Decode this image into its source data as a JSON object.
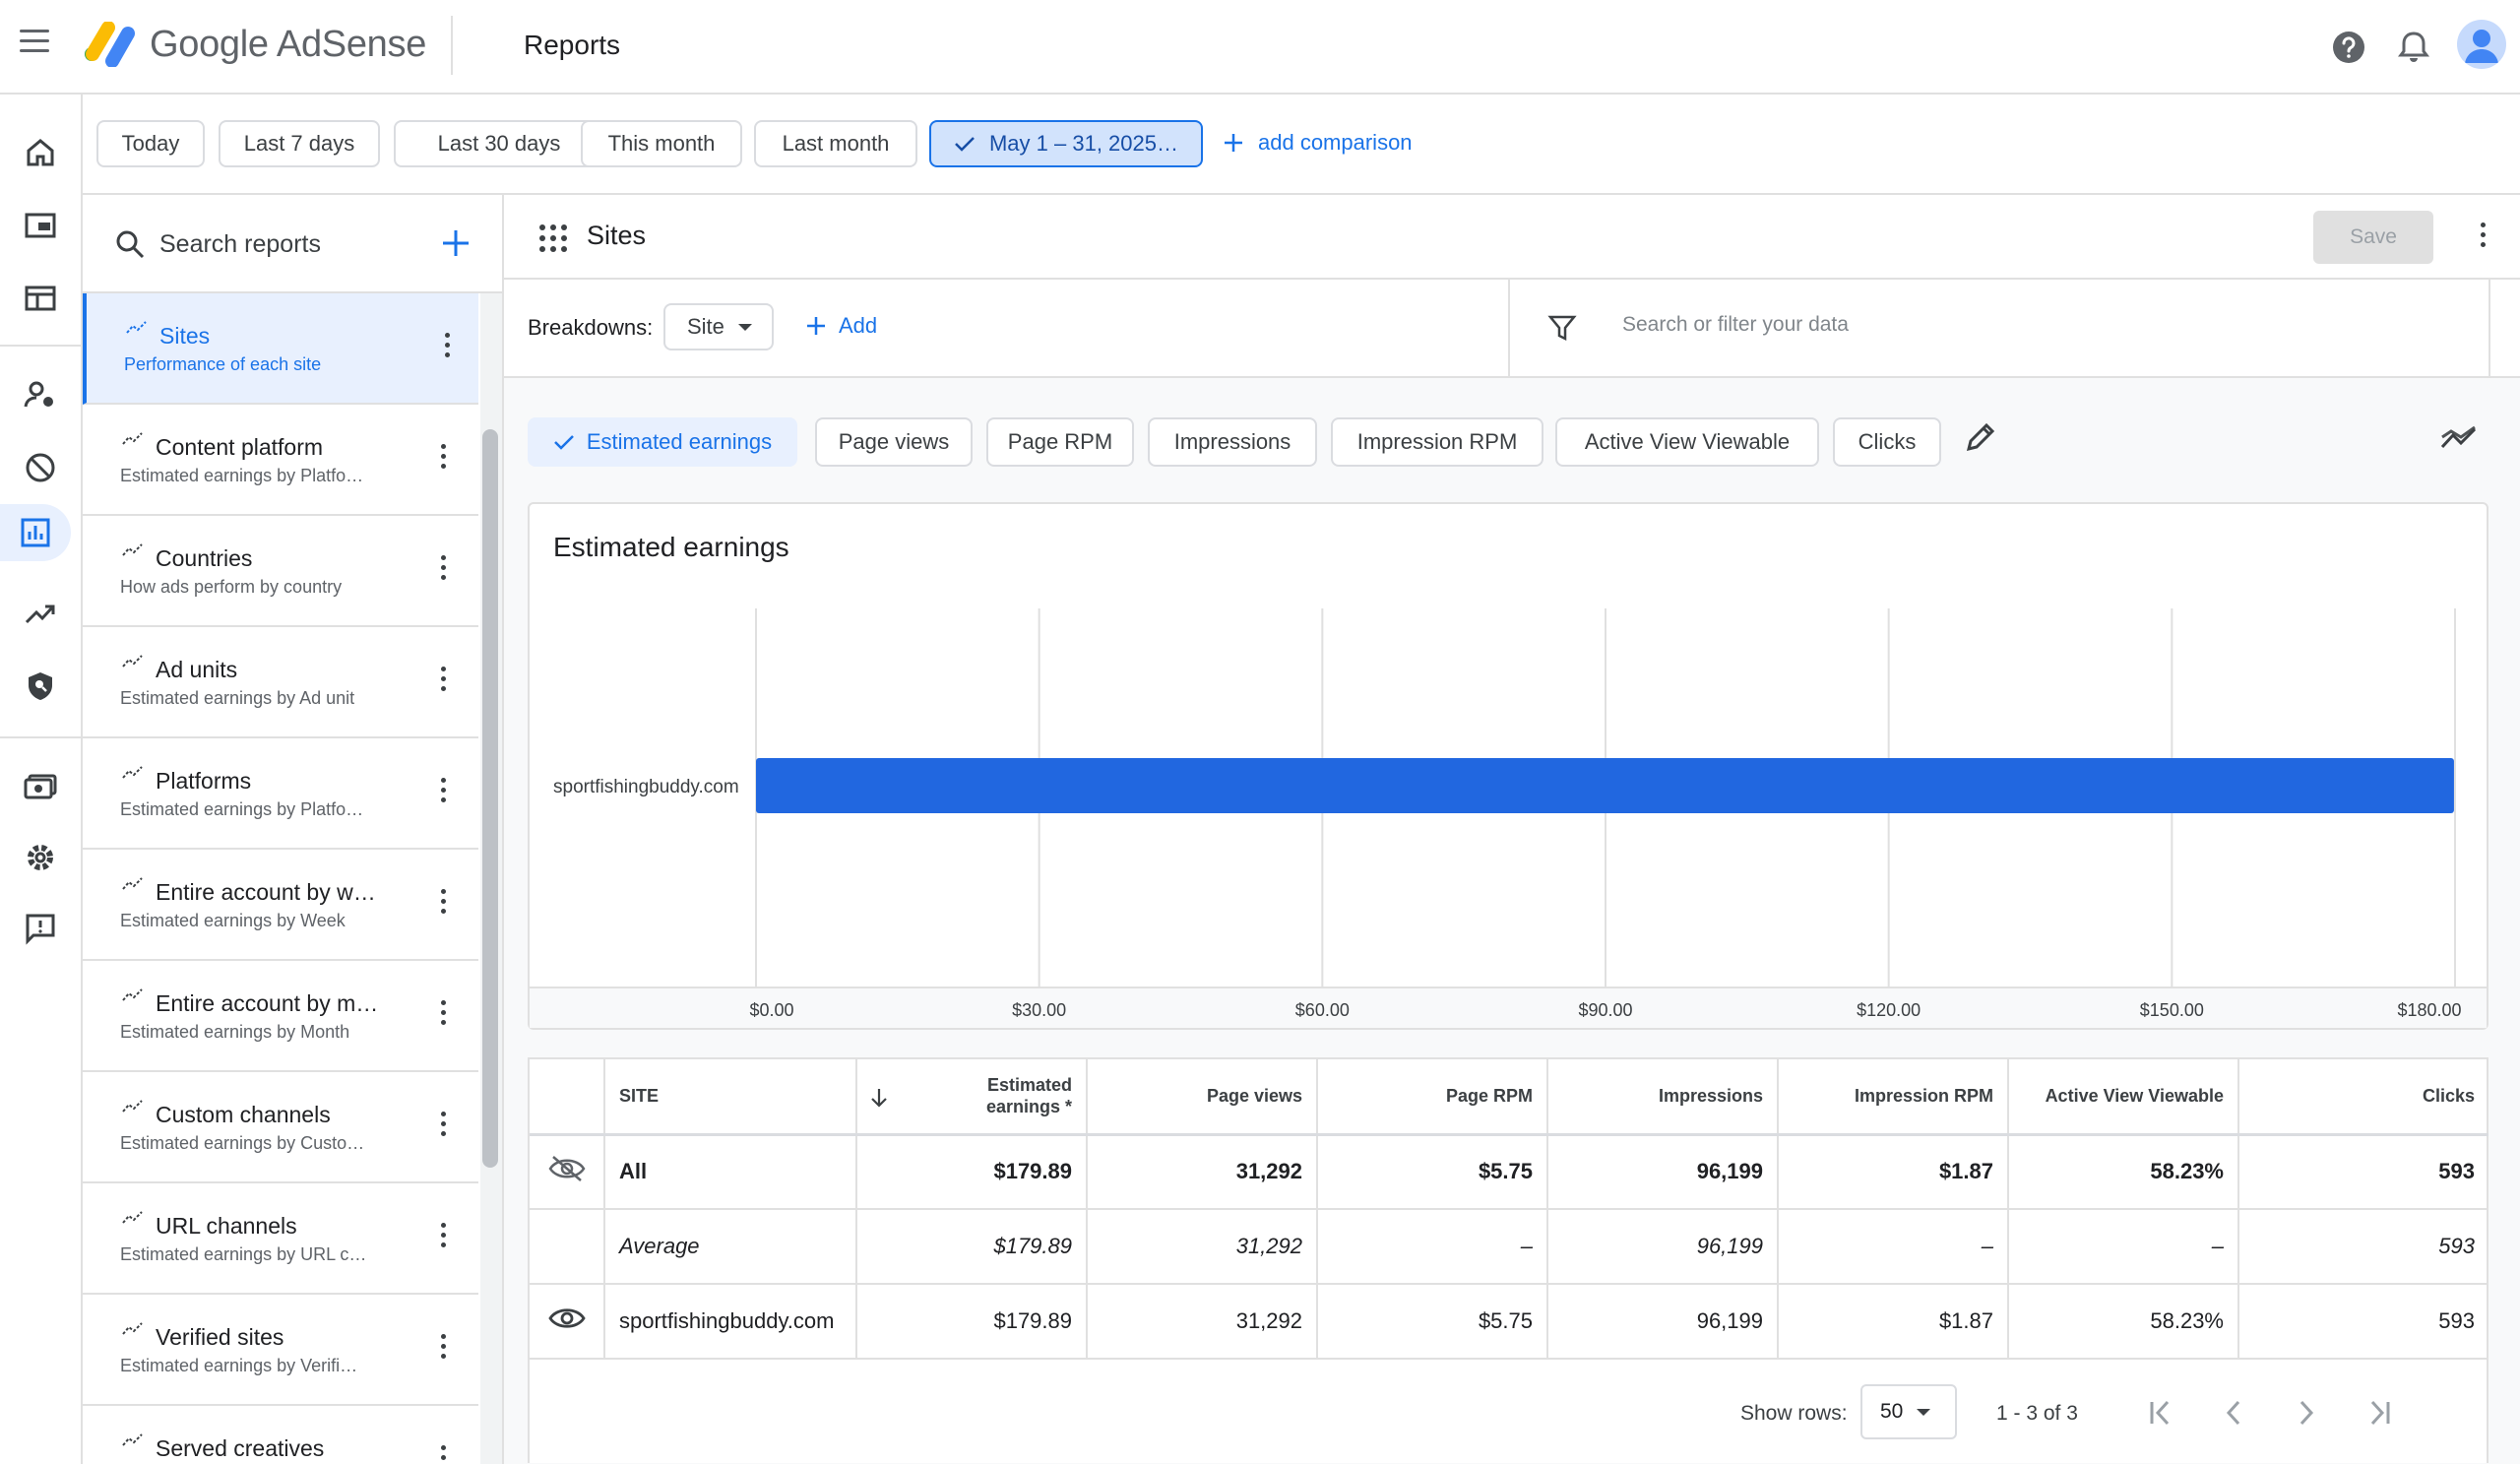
{
  "app": {
    "brand": "Google AdSense",
    "page_title": "Reports"
  },
  "date_filters": {
    "chips": [
      "Today",
      "Last 7 days",
      "Last 30 days",
      "This month",
      "Last month"
    ],
    "selected": "May 1 – 31, 2025…",
    "add_comparison": "add comparison"
  },
  "sidebar": {
    "search_label": "Search reports",
    "reports": [
      {
        "title": "Sites",
        "subtitle": "Performance of each site"
      },
      {
        "title": "Content platform",
        "subtitle": "Estimated earnings by Platfo…"
      },
      {
        "title": "Countries",
        "subtitle": "How ads perform by country"
      },
      {
        "title": "Ad units",
        "subtitle": "Estimated earnings by Ad unit"
      },
      {
        "title": "Platforms",
        "subtitle": "Estimated earnings by Platfo…"
      },
      {
        "title": "Entire account by w…",
        "subtitle": "Estimated earnings by Week"
      },
      {
        "title": "Entire account by m…",
        "subtitle": "Estimated earnings by Month"
      },
      {
        "title": "Custom channels",
        "subtitle": "Estimated earnings by Custo…"
      },
      {
        "title": "URL channels",
        "subtitle": "Estimated earnings by URL c…"
      },
      {
        "title": "Verified sites",
        "subtitle": "Estimated earnings by Verifi…"
      },
      {
        "title": "Served creatives",
        "subtitle": ""
      }
    ]
  },
  "main": {
    "title": "Sites",
    "save_label": "Save",
    "breakdowns_label": "Breakdowns:",
    "breakdown_value": "Site",
    "add_label": "Add",
    "filter_placeholder": "Search or filter your data",
    "metrics": [
      "Estimated earnings",
      "Page views",
      "Page RPM",
      "Impressions",
      "Impression RPM",
      "Active View Viewable",
      "Clicks"
    ]
  },
  "chart_data": {
    "type": "bar",
    "orientation": "horizontal",
    "title": "Estimated earnings",
    "categories": [
      "sportfishingbuddy.com"
    ],
    "values": [
      179.89
    ],
    "xlim": [
      0,
      180
    ],
    "x_ticks": [
      "$0.00",
      "$30.00",
      "$60.00",
      "$90.00",
      "$120.00",
      "$150.00",
      "$180.00"
    ],
    "x_tick_values": [
      0,
      30,
      60,
      90,
      120,
      150,
      180
    ],
    "grid": true,
    "bar_color": "#2167e0"
  },
  "table": {
    "headers": [
      "SITE",
      "Estimated earnings *",
      "Page views",
      "Page RPM",
      "Impressions",
      "Impression RPM",
      "Active View Viewable",
      "Clicks"
    ],
    "rows": [
      {
        "site": "All",
        "cells": [
          "$179.89",
          "31,292",
          "$5.75",
          "96,199",
          "$1.87",
          "58.23%",
          "593"
        ]
      },
      {
        "site": "Average",
        "cells": [
          "$179.89",
          "31,292",
          "–",
          "96,199",
          "–",
          "–",
          "593"
        ]
      },
      {
        "site": "sportfishingbuddy.com",
        "cells": [
          "$179.89",
          "31,292",
          "$5.75",
          "96,199",
          "$1.87",
          "58.23%",
          "593"
        ]
      }
    ],
    "show_rows_label": "Show rows:",
    "rows_per_page": "50",
    "range": "1 - 3 of 3"
  },
  "colors": {
    "accent": "#1a73e8",
    "selected_bg": "#e8f0fe",
    "bar": "#2167e0"
  }
}
